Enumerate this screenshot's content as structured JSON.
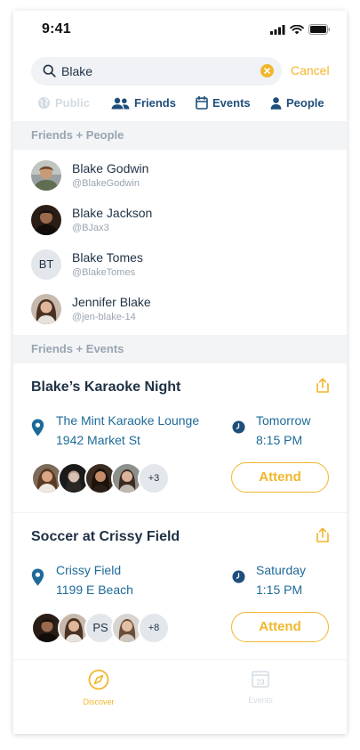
{
  "status_bar": {
    "time": "9:41"
  },
  "search": {
    "query": "Blake",
    "placeholder": "",
    "cancel_label": "Cancel"
  },
  "filters": [
    {
      "label": "Public",
      "icon": "globe-icon",
      "enabled": false
    },
    {
      "label": "Friends",
      "icon": "friends-icon",
      "enabled": true
    },
    {
      "label": "Events",
      "icon": "calendar-icon",
      "enabled": true
    },
    {
      "label": "People",
      "icon": "person-icon",
      "enabled": true
    }
  ],
  "people_section": {
    "title": "Friends + People",
    "people": [
      {
        "name": "Blake Godwin",
        "handle": "@BlakeGodwin",
        "avatar": "photo"
      },
      {
        "name": "Blake Jackson",
        "handle": "@BJax3",
        "avatar": "photo"
      },
      {
        "name": "Blake Tomes",
        "handle": "@BlakeTomes",
        "avatar": "BT"
      },
      {
        "name": "Jennifer Blake",
        "handle": "@jen-blake-14",
        "avatar": "photo"
      }
    ]
  },
  "events_section": {
    "title": "Friends + Events",
    "events": [
      {
        "title": "Blake’s Karaoke Night",
        "venue": "The Mint Karaoke Lounge",
        "address": "1942 Market St",
        "day": "Tomorrow",
        "time": "8:15 PM",
        "attendees": [
          "photo",
          "photo",
          "photo",
          "photo"
        ],
        "more_count": "+3",
        "action_label": "Attend"
      },
      {
        "title": "Soccer at Crissy Field",
        "venue": "Crissy Field",
        "address": "1199 E Beach",
        "day": "Saturday",
        "time": "1:15 PM",
        "attendees": [
          "photo",
          "photo",
          "PS",
          "photo"
        ],
        "more_count": "+8",
        "action_label": "Attend"
      }
    ]
  },
  "bottom_nav": {
    "items": [
      {
        "label": "Discover",
        "icon": "compass-icon",
        "active": true
      },
      {
        "label": "Events",
        "icon": "calendar-icon",
        "active": false,
        "badge": "23"
      }
    ]
  },
  "colors": {
    "accent": "#f1b62b",
    "navy": "#1e4e7a",
    "link_blue": "#1e6a98",
    "muted": "#9aa5b1",
    "section_bg": "#f2f4f6"
  }
}
